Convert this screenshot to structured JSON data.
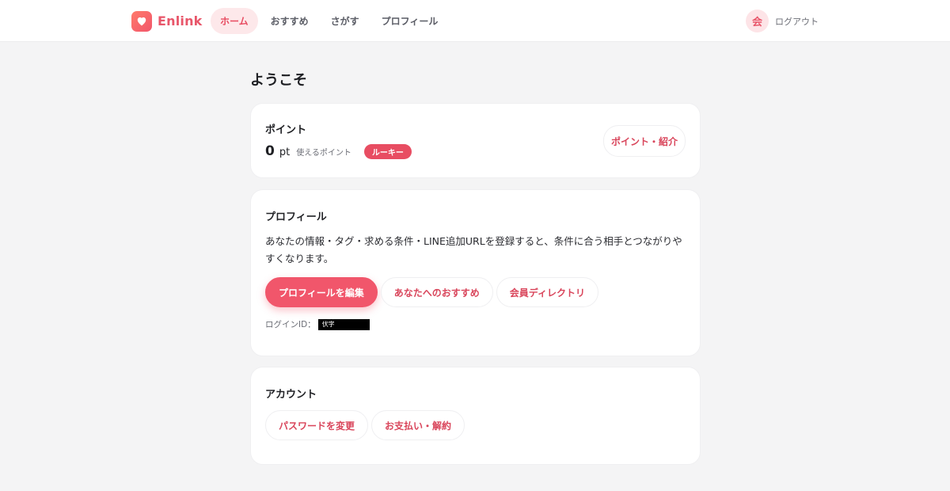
{
  "header": {
    "brand": "Enlink",
    "logo_icon": "heart-icon",
    "nav": [
      {
        "label": "ホーム",
        "active": true
      },
      {
        "label": "おすすめ",
        "active": false
      },
      {
        "label": "さがす",
        "active": false
      },
      {
        "label": "プロフィール",
        "active": false
      }
    ],
    "avatar_initial": "会",
    "logout_label": "ログアウト"
  },
  "main": {
    "title": "ようこそ",
    "points": {
      "title": "ポイント",
      "value": "0",
      "unit": "pt",
      "sub_label": "使えるポイント",
      "rank": "ルーキー",
      "button": "ポイント・紹介"
    },
    "profile": {
      "title": "プロフィール",
      "description": "あなたの情報・タグ・求める条件・LINE追加URLを登録すると、条件に合う相手とつながりやすくなります。",
      "buttons": {
        "edit": "プロフィールを編集",
        "recommend": "あなたへのおすすめ",
        "directory": "会員ディレクトリ"
      },
      "login_label": "ログインID：",
      "login_value": "伏字"
    },
    "account": {
      "title": "アカウント",
      "buttons": {
        "password": "パスワードを変更",
        "billing": "お支払い・解約"
      }
    }
  },
  "colors": {
    "accent": "#f1566b",
    "accent_text": "#d9455b",
    "background": "#f4f4f5"
  }
}
